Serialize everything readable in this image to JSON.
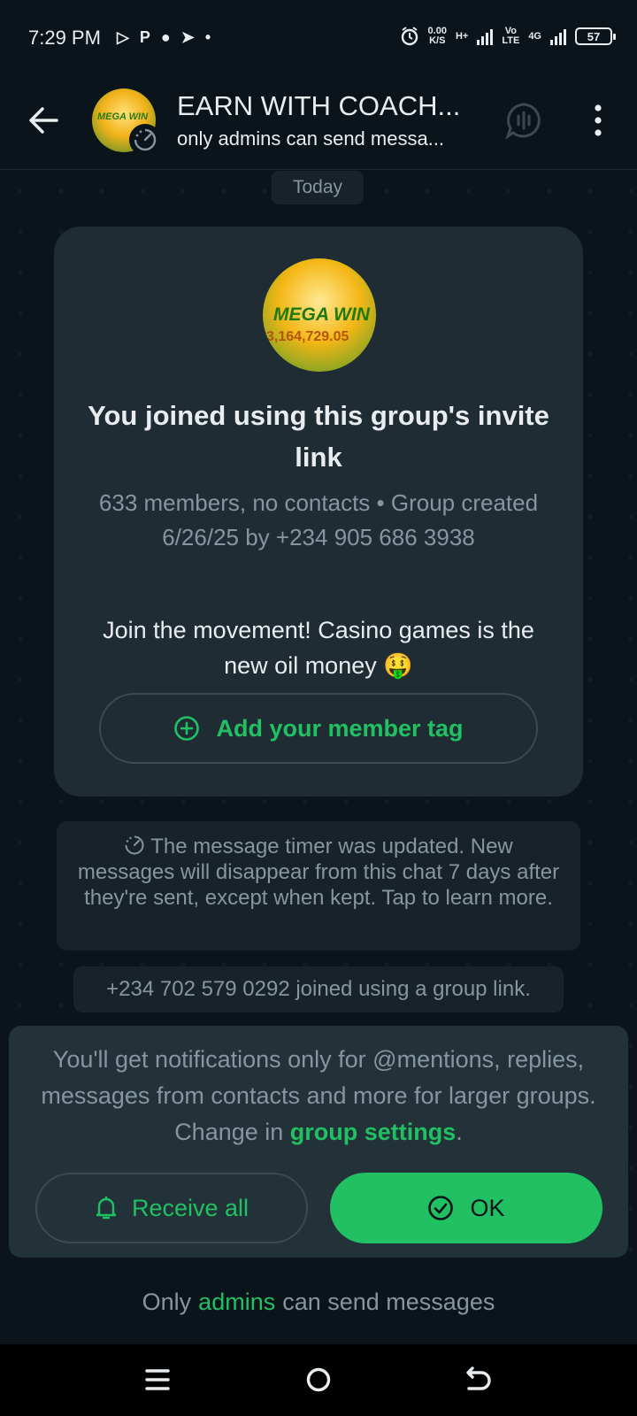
{
  "status_bar": {
    "time": "7:29 PM",
    "left_icons": [
      "media-icon",
      "p-icon",
      "snapchat-icon",
      "telegram-icon",
      "dot-icon"
    ],
    "speed_value": "0.00",
    "speed_unit": "K/S",
    "network_1": "H+",
    "network_2_top": "Vo",
    "network_2_bottom": "LTE",
    "network_3": "4G",
    "battery": "57"
  },
  "header": {
    "title": "EARN WITH COACH...",
    "subtitle": "only admins can send messa...",
    "avatar_text": "MEGA WIN"
  },
  "chat": {
    "date_chip": "Today",
    "invite_card": {
      "avatar_text": "MEGA WIN",
      "avatar_amount": "3,164,729.05",
      "title": "You joined using this group's invite link",
      "meta": "633 members, no contacts • Group created 6/26/25 by +234 905 686 3938",
      "description": "Join the movement! Casino games is the new oil money 🤑",
      "tag_button": "Add your member tag"
    },
    "timer_message": "The message timer was updated. New messages will disappear from this chat 7 days after they're sent, except when kept. Tap to learn more.",
    "join_message": "+234 702 579 0292 joined using a group link."
  },
  "banner": {
    "text_before": "You'll get notifications only for @mentions, replies, messages from contacts and more for larger groups. Change in ",
    "link": "group settings",
    "text_after": ".",
    "receive_all": "Receive all",
    "ok": "OK"
  },
  "footer": {
    "before": "Only",
    "admins": "admins",
    "after": "can send messages"
  },
  "colors": {
    "accent": "#21c063",
    "background": "#0b141a",
    "card": "#1f2c33",
    "muted_text": "#8696a0"
  }
}
